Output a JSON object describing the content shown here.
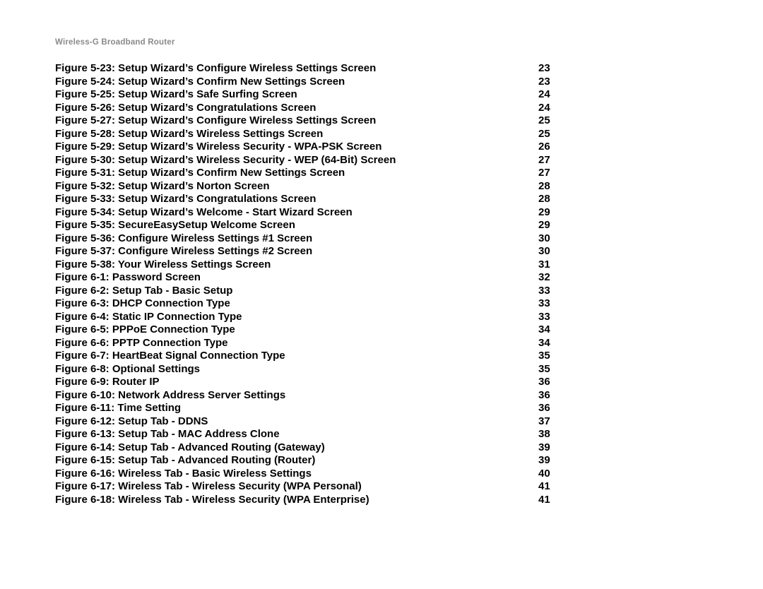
{
  "header": "Wireless-G Broadband Router",
  "entries": [
    {
      "title": "Figure 5-23: Setup Wizard’s Configure Wireless Settings Screen",
      "page": "23"
    },
    {
      "title": "Figure 5-24: Setup Wizard’s Confirm New Settings Screen",
      "page": "23"
    },
    {
      "title": "Figure 5-25: Setup Wizard’s Safe Surfing Screen",
      "page": "24"
    },
    {
      "title": "Figure 5-26: Setup Wizard’s Congratulations Screen",
      "page": "24"
    },
    {
      "title": "Figure 5-27: Setup Wizard’s Configure Wireless Settings Screen",
      "page": "25"
    },
    {
      "title": "Figure 5-28: Setup Wizard’s Wireless Settings Screen",
      "page": "25"
    },
    {
      "title": "Figure 5-29: Setup Wizard’s Wireless Security - WPA-PSK Screen",
      "page": "26"
    },
    {
      "title": "Figure 5-30: Setup Wizard’s Wireless Security - WEP (64-Bit) Screen",
      "page": "27"
    },
    {
      "title": "Figure 5-31: Setup Wizard’s Confirm New Settings Screen",
      "page": "27"
    },
    {
      "title": "Figure 5-32: Setup Wizard’s Norton Screen",
      "page": "28"
    },
    {
      "title": "Figure 5-33: Setup Wizard’s Congratulations Screen",
      "page": "28"
    },
    {
      "title": "Figure 5-34: Setup Wizard’s Welcome - Start Wizard Screen",
      "page": "29"
    },
    {
      "title": "Figure 5-35: SecureEasySetup Welcome Screen",
      "page": "29"
    },
    {
      "title": "Figure 5-36: Configure Wireless Settings #1 Screen",
      "page": "30"
    },
    {
      "title": "Figure 5-37: Configure Wireless Settings #2 Screen",
      "page": "30"
    },
    {
      "title": "Figure 5-38: Your Wireless Settings Screen",
      "page": "31"
    },
    {
      "title": "Figure 6-1: Password Screen",
      "page": "32"
    },
    {
      "title": "Figure 6-2: Setup Tab - Basic Setup",
      "page": "33"
    },
    {
      "title": "Figure 6-3: DHCP Connection Type",
      "page": "33"
    },
    {
      "title": "Figure 6-4: Static IP Connection Type",
      "page": "33"
    },
    {
      "title": "Figure 6-5: PPPoE Connection Type",
      "page": "34"
    },
    {
      "title": "Figure 6-6: PPTP Connection Type",
      "page": "34"
    },
    {
      "title": "Figure 6-7: HeartBeat Signal Connection Type",
      "page": "35"
    },
    {
      "title": "Figure 6-8: Optional Settings",
      "page": "35"
    },
    {
      "title": "Figure 6-9: Router IP",
      "page": "36"
    },
    {
      "title": "Figure 6-10: Network Address Server Settings",
      "page": "36"
    },
    {
      "title": "Figure 6-11: Time Setting",
      "page": "36"
    },
    {
      "title": "Figure 6-12: Setup Tab - DDNS",
      "page": "37"
    },
    {
      "title": "Figure 6-13: Setup Tab - MAC Address Clone",
      "page": "38"
    },
    {
      "title": "Figure 6-14: Setup Tab - Advanced Routing (Gateway)",
      "page": "39"
    },
    {
      "title": "Figure 6-15: Setup Tab - Advanced Routing (Router)",
      "page": "39"
    },
    {
      "title": "Figure 6-16: Wireless Tab - Basic Wireless Settings",
      "page": "40"
    },
    {
      "title": "Figure 6-17: Wireless Tab - Wireless Security (WPA Personal)",
      "page": "41"
    },
    {
      "title": "Figure 6-18: Wireless Tab - Wireless Security (WPA Enterprise)",
      "page": "41"
    }
  ]
}
